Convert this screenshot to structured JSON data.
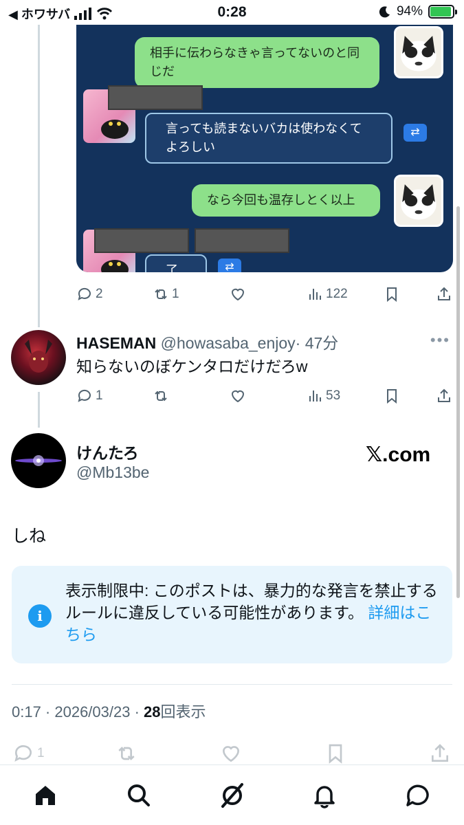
{
  "status_bar": {
    "back_label": "◀ ホワサバ",
    "time": "0:28",
    "battery": "94%"
  },
  "image": {
    "msg1": "相手に伝わらなきゃ言ってないのと同じだ",
    "msg2": "言っても読まないバカは使わなくてよろしい",
    "msg3": "なら今回も温存しとく以上",
    "msg4": "了解"
  },
  "tweet1_actions": {
    "replies": "2",
    "retweets": "1",
    "views": "122"
  },
  "reply": {
    "name": "HASEMAN",
    "handle": "@howasaba_enjoy",
    "time": "· 47分",
    "text": "知らないのぼケンタロだけだろw",
    "replies": "1",
    "views": "53"
  },
  "main": {
    "name": "けんたろ",
    "handle": "@Mb13be",
    "badge": "𝕏.com",
    "text": "しね",
    "notice": "表示制限中: このポストは、暴力的な発言を禁止するルールに違反している可能性があります。",
    "notice_link": "詳細はこちら",
    "timestamp": "0:17 · 2026/03/23 · ",
    "views_count": "28",
    "views_label": "回表示",
    "faded_replies": "1"
  },
  "colors": {
    "accent": "#1d9bf0",
    "muted": "#536471",
    "image_bg": "#13325c"
  }
}
